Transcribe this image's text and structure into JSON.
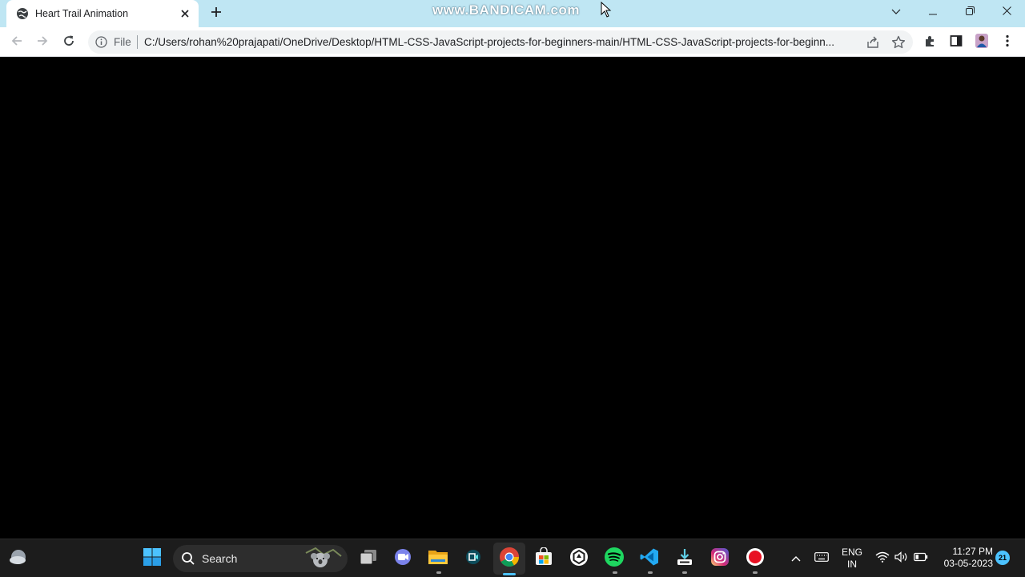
{
  "browser": {
    "tab": {
      "title": "Heart Trail Animation"
    },
    "address_bar": {
      "scheme_label": "File",
      "url": "C:/Users/rohan%20prajapati/OneDrive/Desktop/HTML-CSS-JavaScript-projects-for-beginners-main/HTML-CSS-JavaScript-projects-for-beginn..."
    },
    "watermark": "www.BANDICAM.com",
    "icons": [
      "globe-icon",
      "close-icon",
      "plus-icon",
      "chevron-down-icon",
      "minimize-icon",
      "restore-icon",
      "back-icon",
      "forward-icon",
      "reload-icon",
      "info-icon",
      "share-icon",
      "star-icon",
      "extensions-icon",
      "side-panel-icon",
      "profile-avatar",
      "menu-icon"
    ]
  },
  "taskbar": {
    "search_label": "Search",
    "language": {
      "line1": "ENG",
      "line2": "IN"
    },
    "clock": {
      "time": "11:27 PM",
      "date": "03-05-2023"
    },
    "notification_count": "21",
    "colors": {
      "background": "#1c1c1c",
      "accent": "#4cc2ff",
      "spotify": "#1ed760",
      "vscode": "#23a9f2",
      "record": "#e81123"
    }
  }
}
